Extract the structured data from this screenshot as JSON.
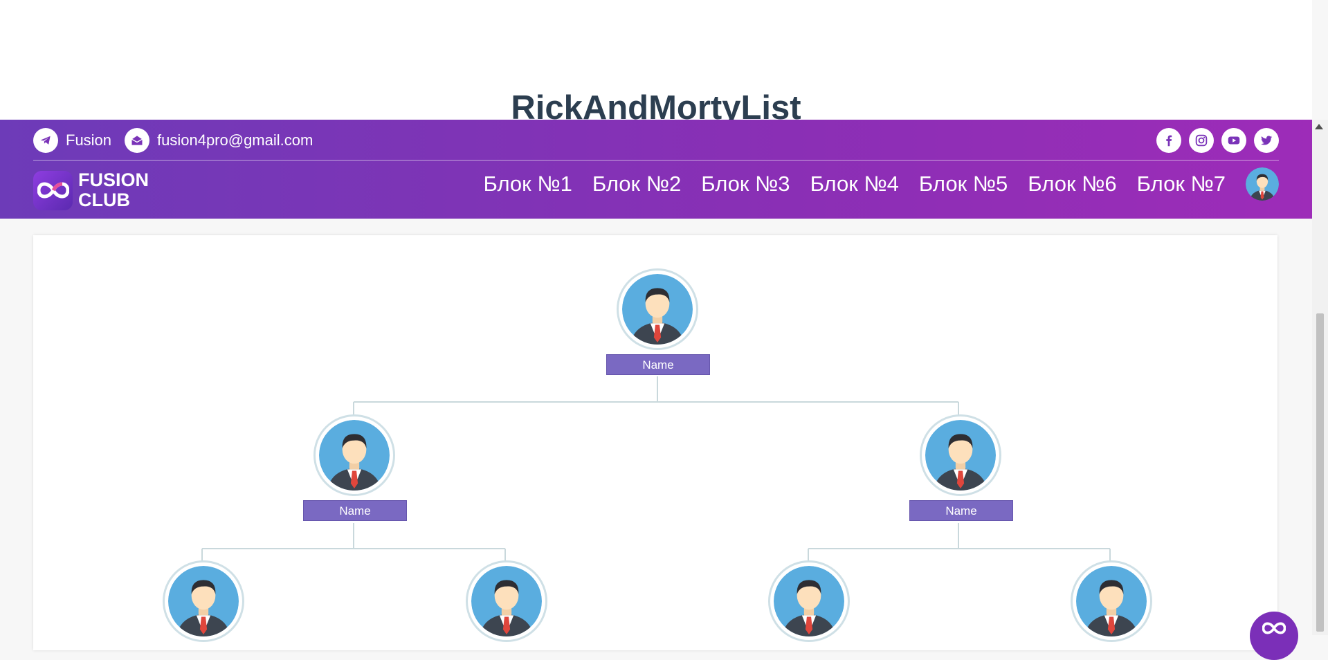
{
  "page": {
    "title": "RickAndMortyList"
  },
  "topbar": {
    "telegram_label": "Fusion",
    "email": "fusion4pro@gmail.com",
    "socials": [
      "facebook-icon",
      "instagram-icon",
      "youtube-icon",
      "twitter-icon"
    ]
  },
  "brand": {
    "line1": "FUSION",
    "line2": "CLUB"
  },
  "nav": {
    "items": [
      "Блок №1",
      "Блок №2",
      "Блок №3",
      "Блок №4",
      "Блок №5",
      "Блок №6",
      "Блок №7"
    ]
  },
  "tree": {
    "root": {
      "label": "Name"
    },
    "level2": [
      {
        "label": "Name"
      },
      {
        "label": "Name"
      }
    ],
    "level3_count_visible": 4
  },
  "colors": {
    "header_start": "#6d3bb8",
    "header_end": "#9d2cb8",
    "name_tag": "#7a69c2",
    "title": "#2c3e50"
  }
}
